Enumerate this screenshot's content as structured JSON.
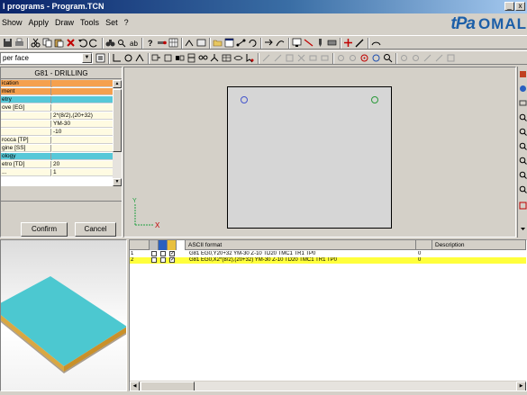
{
  "window": {
    "title": "I programs - Program.TCN",
    "controls": [
      "_",
      "x"
    ]
  },
  "menu": {
    "items": [
      "Show",
      "Apply",
      "Draw",
      "Tools",
      "Set",
      "?"
    ]
  },
  "logo": {
    "mark": "tPa",
    "text": "OMAL"
  },
  "toolbar": {
    "face_combo_value": "per face"
  },
  "props": {
    "title": "G81 - DRILLING",
    "rows": [
      {
        "k": "ication",
        "v": "",
        "color": "#f5a04e"
      },
      {
        "k": "ment",
        "v": "",
        "color": "#f5a04e"
      },
      {
        "k": "etry",
        "v": "",
        "color": "#57c8d8"
      },
      {
        "k": "ove [EG]",
        "v": "",
        "color": "#fffbe2"
      },
      {
        "k": "",
        "v": "2*(8/2),(20+32)",
        "color": "#fffbe2"
      },
      {
        "k": "",
        "v": "YM-30",
        "color": "#fffbe2"
      },
      {
        "k": "",
        "v": "-10",
        "color": "#fffbe2"
      },
      {
        "k": "rocca [TP]",
        "v": "",
        "color": "#fffbe2"
      },
      {
        "k": "gine [SS]",
        "v": "",
        "color": "#fffbe2"
      },
      {
        "k": "ology",
        "v": "",
        "color": "#57c8d8"
      },
      {
        "k": "etro [TD]",
        "v": "20",
        "color": "#fffbe2"
      },
      {
        "k": "...",
        "v": "1",
        "color": "#fffbe2"
      }
    ],
    "confirm_label": "Confirm",
    "cancel_label": "Cancel"
  },
  "drawing": {
    "axis_y_label": "Y",
    "axis_x_label": "X",
    "hole_colors": [
      "#4455cc",
      "#2a9a3a"
    ]
  },
  "listing": {
    "columns": {
      "ascii": "ASCII format",
      "description": "Description"
    },
    "rows": [
      {
        "num": "1",
        "code": "G81 EG0,Y20+32 YM-30 Z-10 TD20 TMC1 TR1 TP0",
        "value": "0",
        "checked": true,
        "selected": false
      },
      {
        "num": "2",
        "code": "G81 EG0,X2*(8/2),(20+32) YM-30 Z-10 TD20 TMC1 TR1 TP0",
        "value": "0",
        "checked": true,
        "selected": true
      }
    ]
  },
  "colors": {
    "selection_row": "#ffff3c",
    "workpiece_top": "#4cc8d0",
    "workpiece_edge": "#d9a742"
  }
}
